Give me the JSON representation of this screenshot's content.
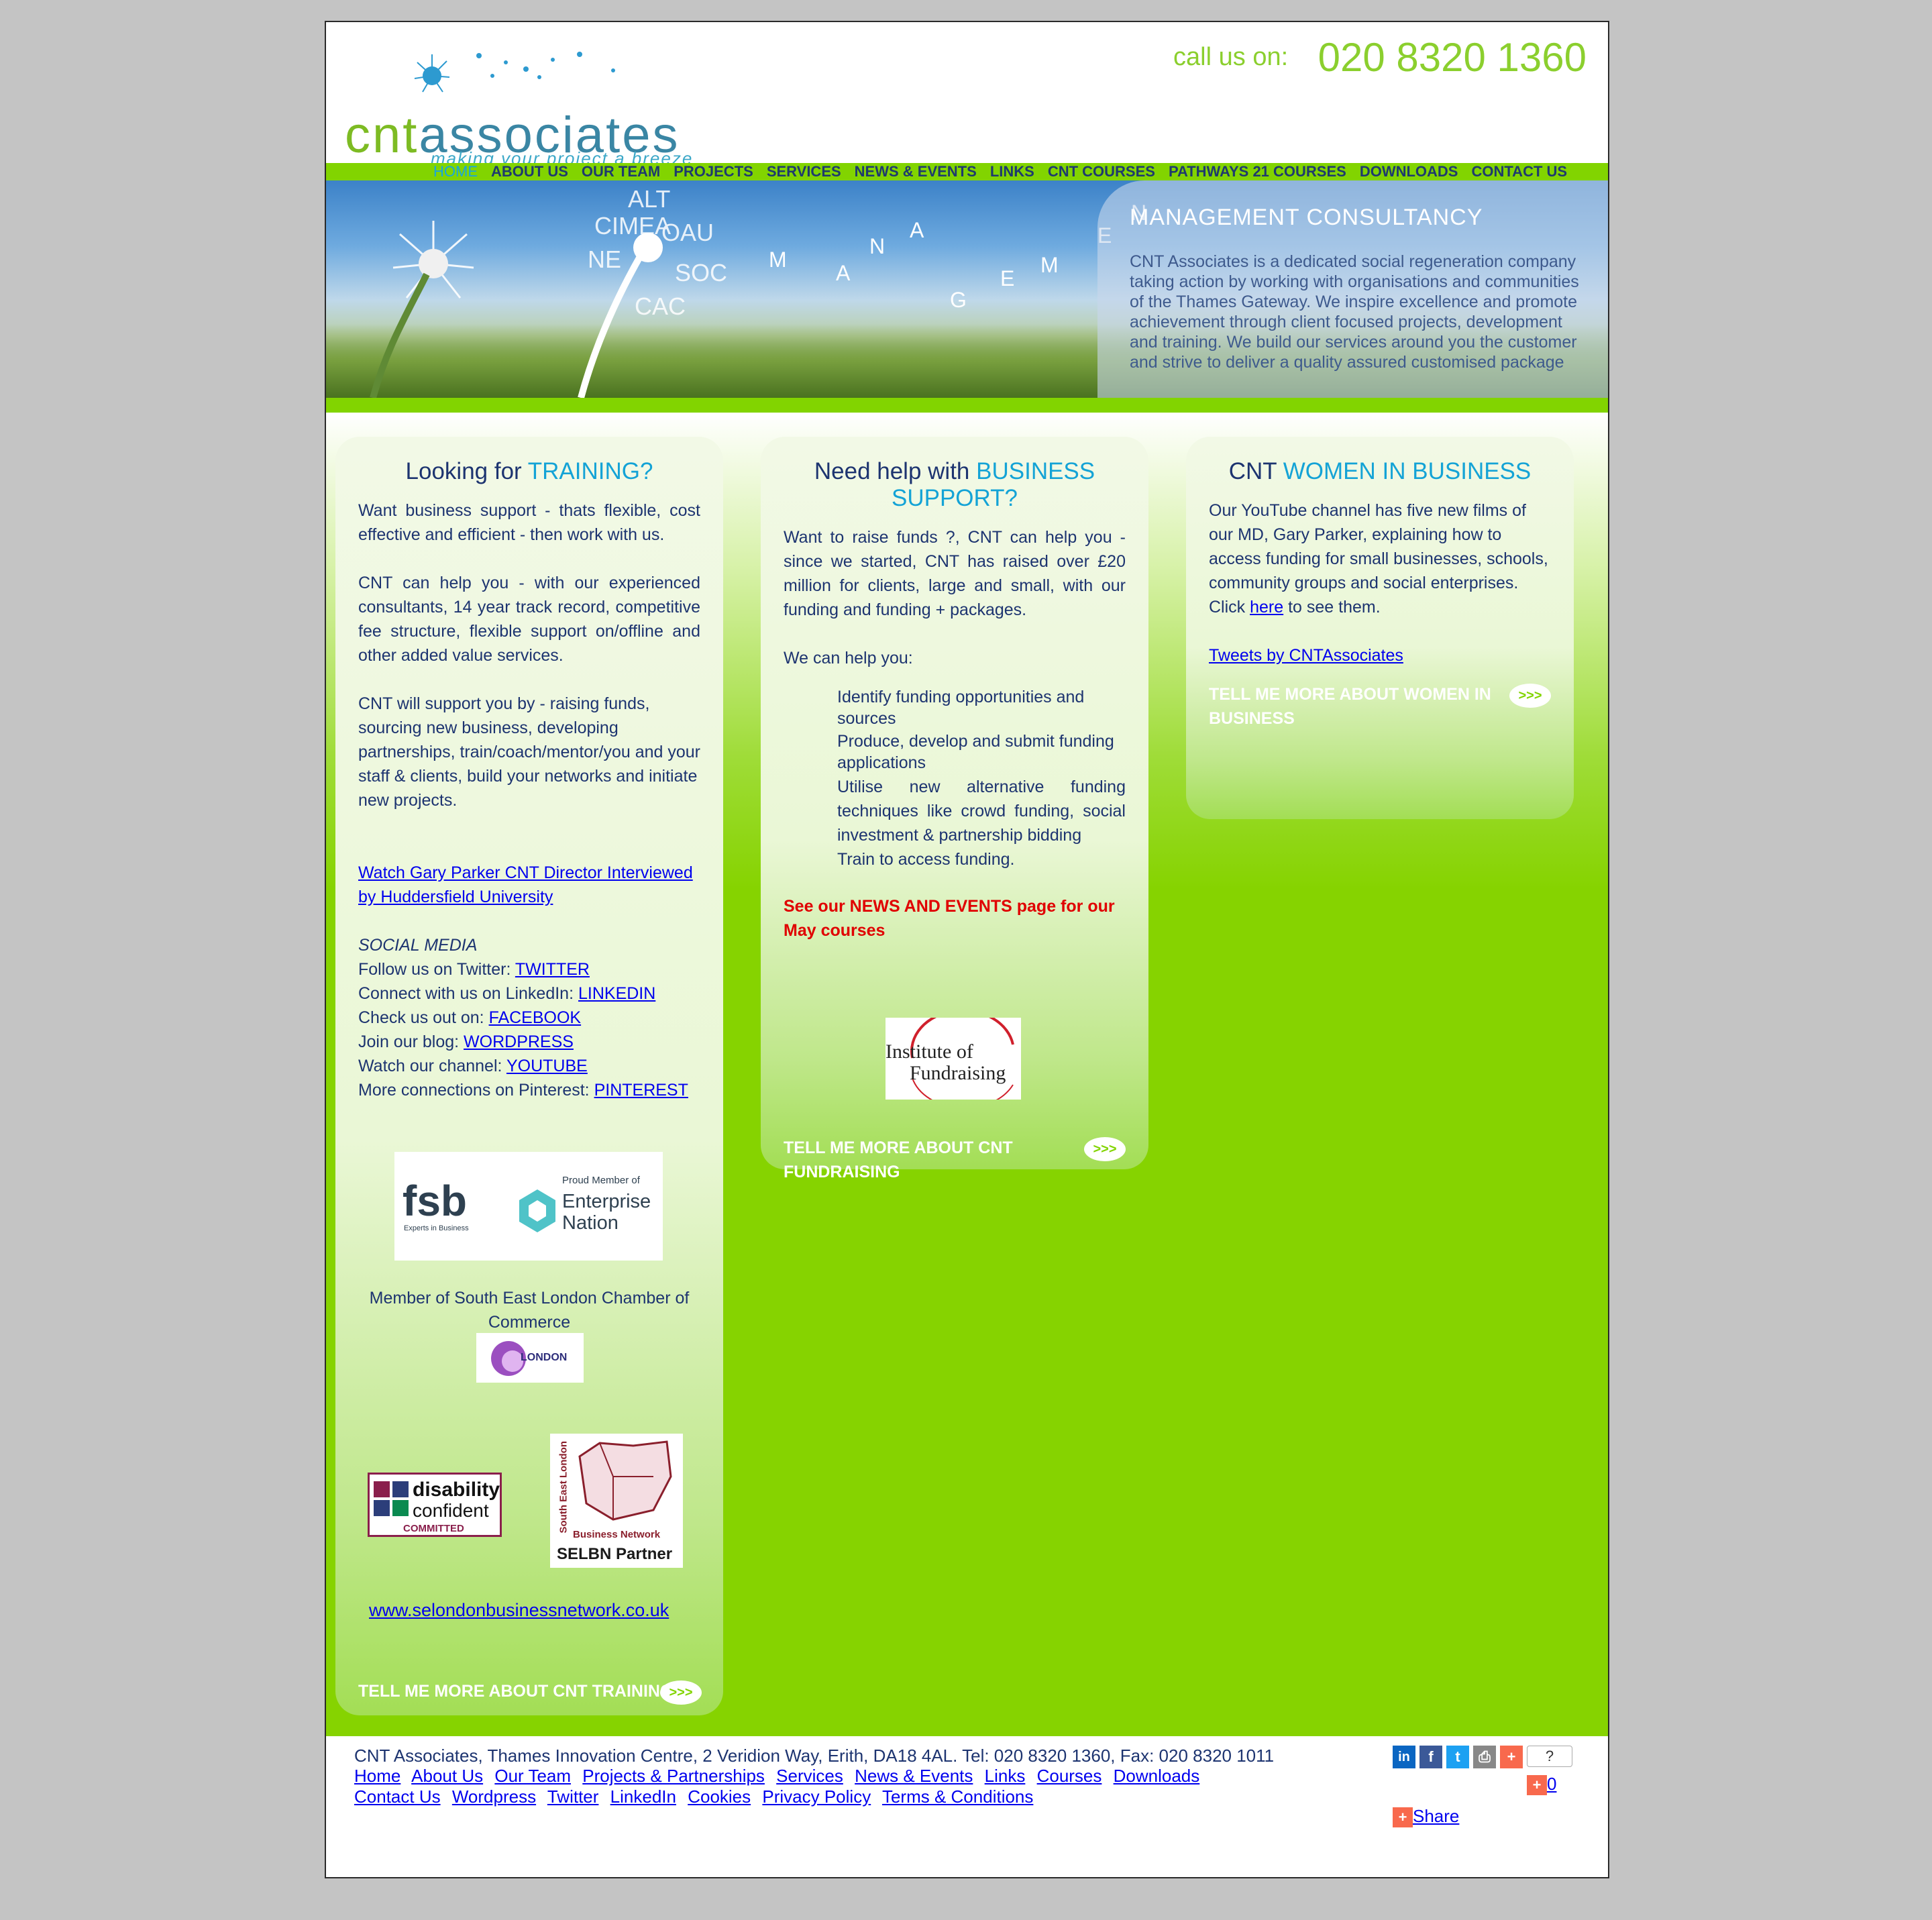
{
  "header": {
    "logo_cnt": "cnt",
    "logo_rest": "associates",
    "tagline": "making your project a breeze",
    "call_label": "call us on:",
    "call_number": "020 8320 1360"
  },
  "nav": {
    "items": [
      "HOME",
      "ABOUT US",
      "OUR TEAM",
      "PROJECTS",
      "SERVICES",
      "NEWS & EVENTS",
      "LINKS",
      "CNT COURSES",
      "PATHWAYS 21 COURSES",
      "DOWNLOADS",
      "CONTACT US"
    ],
    "active": "HOME"
  },
  "banner": {
    "heading": "MANAGEMENT CONSULTANCY",
    "text": "CNT Associates is a dedicated social regeneration company taking action by working with organisations and communities of the Thames Gateway.  We inspire excellence and promote achievement through client focused projects, development and training. We build our services around you the customer and strive to deliver a quality assured customised package",
    "letters": [
      "M",
      "A",
      "N",
      "A",
      "G",
      "E",
      "M",
      "E",
      "N"
    ]
  },
  "training": {
    "title_plain": "Looking for ",
    "title_highlight": "TRAINING?",
    "p1": "Want business support - thats flexible, cost effective and efficient - then work with us.",
    "p2": "CNT can help you - with our experienced consultants, 14 year track record, competitive fee structure, flexible support on/offline and other added value services.",
    "p3": "CNT will support you by - raising funds, sourcing new business, developing partnerships, train/coach/mentor/you and your staff & clients, build your networks and initiate new projects.",
    "video_link": "Watch Gary Parker CNT Director Interviewed by Huddersfield University",
    "social_heading": "SOCIAL MEDIA",
    "social": [
      {
        "label": "Follow us on Twitter: ",
        "link": "TWITTER"
      },
      {
        "label": "Connect with us on LinkedIn: ",
        "link": "LINKEDIN"
      },
      {
        "label": "Check us out on: ",
        "link": "FACEBOOK"
      },
      {
        "label": "Join our blog: ",
        "link": "WORDPRESS"
      },
      {
        "label": "Watch our channel: ",
        "link": "YOUTUBE"
      },
      {
        "label": "More connections on Pinterest: ",
        "link": "PINTEREST"
      }
    ],
    "fsb_logo": "fsb",
    "fsb_sub": "Experts in Business",
    "en_top": "Proud Member of",
    "en_name": "Enterprise Nation",
    "chamber_text": "Member of South East London Chamber of Commerce",
    "chamber_logo": "LONDON",
    "disability_line1": "disability",
    "disability_line2": "confident",
    "disability_line3": "COMMITTED",
    "selbn_side": "South East London",
    "selbn_network": "Business Network",
    "selbn_partner": "SELBN Partner",
    "website_link": "www.selondonbusinessnetwork.co.uk",
    "tell_more": "TELL ME MORE ABOUT CNT TRAINING",
    "arrow": ">>>"
  },
  "business": {
    "title_plain": "Need help with ",
    "title_highlight": "BUSINESS SUPPORT?",
    "p1": "Want to raise funds ?, CNT can help you - since we started, CNT has raised over £20 million for clients, large and small, with our funding and funding + packages.",
    "p2": "We can help you:",
    "list": [
      "Identify funding opportunities and sources",
      "Produce, develop and submit funding applications",
      "Utilise new alternative funding techniques like crowd funding, social investment & partnership bidding",
      "Train to access funding."
    ],
    "news_prefix": "See our ",
    "news_link": "NEWS AND EVENTS",
    "news_suffix": " page for our May courses",
    "iof_line1": "Institute of",
    "iof_line2": "Fundraising",
    "tell_more": "TELL ME MORE ABOUT CNT FUNDRAISING",
    "arrow": ">>>"
  },
  "women": {
    "title_plain": "CNT ",
    "title_highlight": "WOMEN IN BUSINESS",
    "p1_before": "Our YouTube channel has five new films of our MD, Gary Parker, explaining how to access funding for small businesses, schools, community groups and social enterprises. Click ",
    "p1_link": "here",
    "p1_after": " to see them.",
    "tweets_link": "Tweets by CNTAssociates",
    "tell_more": "TELL ME MORE ABOUT WOMEN IN BUSINESS",
    "arrow": ">>>"
  },
  "footer": {
    "address": "CNT Associates, Thames Innovation Centre, 2 Veridion Way, Erith, DA18 4AL. Tel: 020 8320 1360, Fax: 020 8320 1011",
    "links": [
      "Home",
      "About Us",
      "Our Team",
      "Projects & Partnerships",
      "Services",
      "News & Events",
      "Links",
      "Courses",
      "Downloads",
      "Contact Us",
      "Wordpress",
      "Twitter",
      "LinkedIn",
      "Cookies",
      "Privacy Policy",
      "Terms & Conditions"
    ],
    "share_count_unknown": "?",
    "share_count": "0",
    "share_label": "Share",
    "share_icons": [
      {
        "name": "linkedin-icon",
        "glyph": "in",
        "color": "#0b66c2"
      },
      {
        "name": "facebook-icon",
        "glyph": "f",
        "color": "#3b5998"
      },
      {
        "name": "twitter-icon",
        "glyph": "t",
        "color": "#1da1f2"
      },
      {
        "name": "print-icon",
        "glyph": "⎙",
        "color": "#888888"
      },
      {
        "name": "addthis-icon",
        "glyph": "+",
        "color": "#f8694d"
      }
    ]
  }
}
